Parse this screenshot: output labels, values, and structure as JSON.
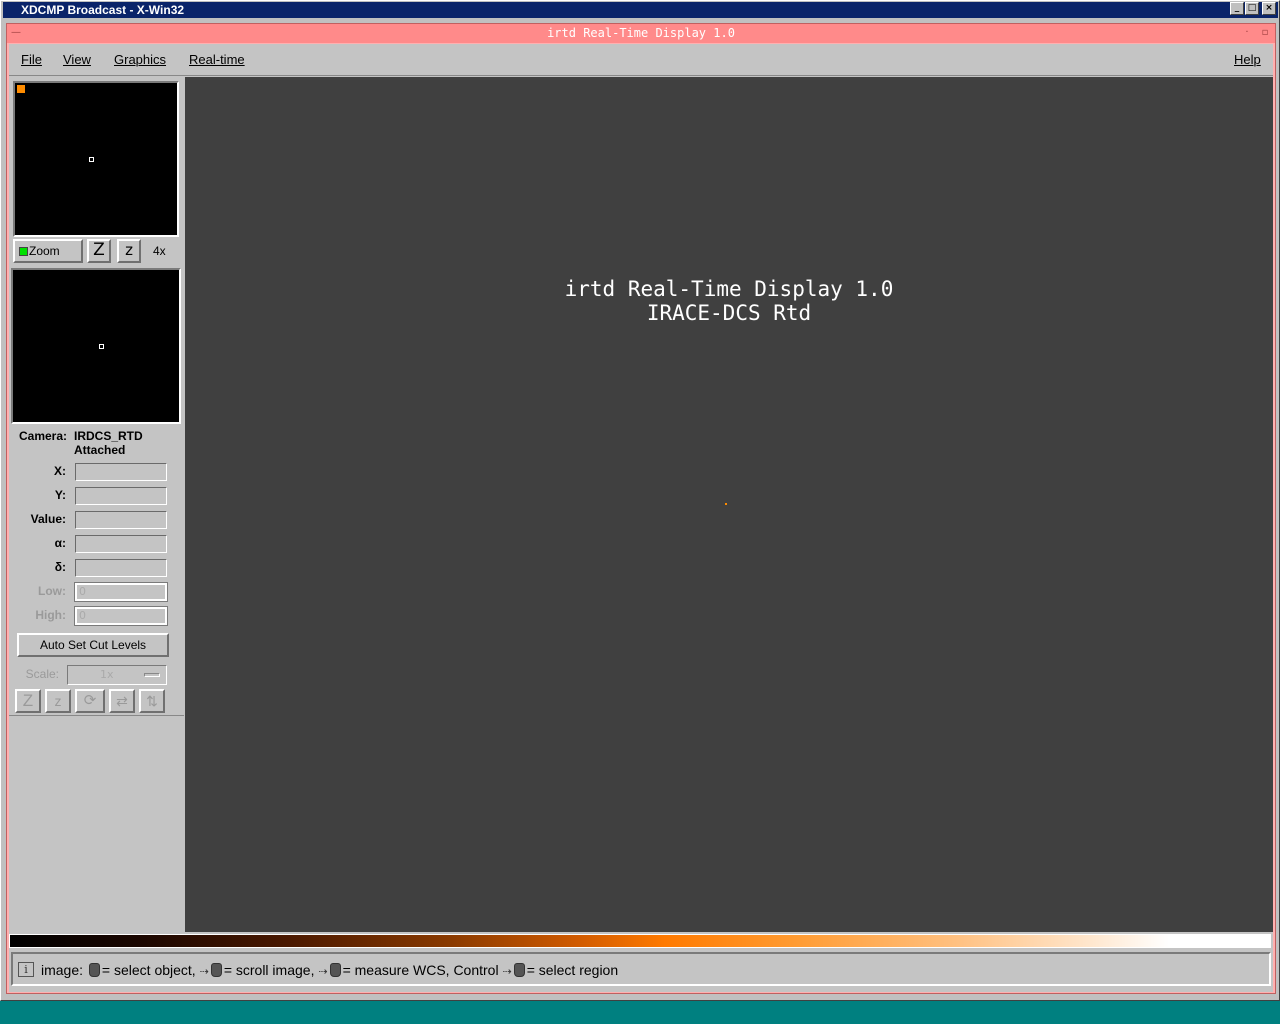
{
  "window": {
    "title": "XDCMP Broadcast - X-Win32",
    "minimize": "_",
    "maximize": "□",
    "close": "×"
  },
  "xwindow": {
    "title": "irtd Real-Time Display 1.0"
  },
  "menu": {
    "file": "File",
    "view": "View",
    "graphics": "Graphics",
    "realtime": "Real-time",
    "help": "Help"
  },
  "zoom": {
    "label": "Zoom",
    "zoom_in": "Z",
    "zoom_out": "z",
    "factor": "4x"
  },
  "info": {
    "camera_label": "Camera:",
    "camera_value": "IRDCS_RTD",
    "camera_status": "Attached",
    "x_label": "X:",
    "y_label": "Y:",
    "value_label": "Value:",
    "alpha_label": "α:",
    "delta_label": "δ:",
    "low_label": "Low:",
    "low_value": "0",
    "high_label": "High:",
    "high_value": "0",
    "auto_cut_button": "Auto Set Cut Levels",
    "scale_label": "Scale:",
    "scale_value": "1x"
  },
  "splash": {
    "line1": "irtd Real-Time Display 1.0",
    "line2": "IRACE-DCS Rtd"
  },
  "status": {
    "icon": "i",
    "prefix": "image:",
    "part1": "= select object,",
    "part2": "= scroll image,",
    "part3": "= measure WCS, Control",
    "part4": "= select region"
  },
  "colors": {
    "accent_marker": "#ff8c00",
    "xtitle": "#ff8a8a",
    "canvas": "#404040"
  }
}
